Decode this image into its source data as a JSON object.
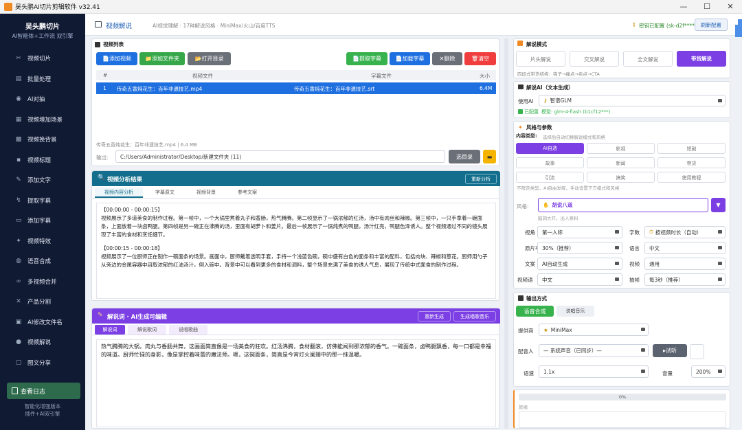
{
  "window": {
    "title": "吴头鹏AI切片剪辑软件 v32.41"
  },
  "sidebar": {
    "title": "吴头鹏切片",
    "subtitle": "AI智能体+工作流 双引擎",
    "items": [
      {
        "label": "视频切片",
        "icon": "scissors-icon"
      },
      {
        "label": "批量处理",
        "icon": "folder-icon"
      },
      {
        "label": "AI对抽",
        "icon": "ai-icon"
      },
      {
        "label": "视频增加场景",
        "icon": "film-icon"
      },
      {
        "label": "视频换背景",
        "icon": "image-icon"
      },
      {
        "label": "视频标题",
        "icon": "title-icon"
      },
      {
        "label": "添加文字",
        "icon": "pencil-icon"
      },
      {
        "label": "提取字幕",
        "icon": "extract-icon"
      },
      {
        "label": "添加字幕",
        "icon": "subtitle-icon"
      },
      {
        "label": "视频特效",
        "icon": "sparkle-icon"
      },
      {
        "label": "语音合成",
        "icon": "speech-icon"
      },
      {
        "label": "多视频合并",
        "icon": "link-icon"
      },
      {
        "label": "产品分割",
        "icon": "cross-icon"
      },
      {
        "label": "AI修改文件名",
        "icon": "rename-icon"
      },
      {
        "label": "视频解说",
        "icon": "mic-icon"
      },
      {
        "label": "图文分享",
        "icon": "share-icon"
      }
    ],
    "log_label": "查看日志",
    "footer1": "智能化增强版本",
    "footer2": "插件+AI双引擎"
  },
  "topbar": {
    "section": "视频解说",
    "desc": "AI视觉理解 · 17种解说风格 · MiniMax/火山/百度TTS",
    "key_status": "密钥已配置 (sk-d2f****)",
    "refresh_label": "刷新配置"
  },
  "video_list": {
    "title": "视频列表",
    "buttons": {
      "add_video": "添加视频",
      "add_folder": "添加文件夹",
      "open_dir": "打开目录",
      "extract_sub": "提取字幕",
      "load_sub": "加载字幕",
      "delete": "删除",
      "clear": "清空"
    },
    "columns": [
      "#",
      "视频文件",
      "字幕文件",
      "大小"
    ],
    "rows": [
      {
        "n": "1",
        "video": "传奇五香炖花生：百年非遗技艺.mp4",
        "sub": "传奇五香炖花生：百年非遗技艺.srt",
        "size": "6.4M"
      }
    ],
    "status": "传奇五香炖花生：百年非遗技艺.mp4 | 6.4 MB",
    "output_label": "输出:",
    "output_path": "C:/Users/Administrator/Desktop/新建文件夹 (11)",
    "choose_dir": "选目录"
  },
  "analysis": {
    "title": "视频分析结果",
    "reanalyze": "重新分析",
    "tabs": [
      "视频内容分析",
      "字幕原文",
      "视频背景",
      "参考文案"
    ],
    "paragraphs": [
      "【00:00:00 - 00:00:15】",
      "视频展示了多道美食的制作过程。第一帧中，一个大锅里煮着丸子和香肠，热气腾腾。第二帧显示了一锅浓郁的红汤，汤中有肉丝和辣椒。第三帧中，一只手拿着一碗面条，上面放着一块卤鸭腿。第四帧是另一碗正在沸腾的汤，里面有胡萝卜和姜片。最后一帧展示了一锅炖煮的鸭腿，汤汁红亮，鸭腿色泽诱人。整个视频通过不同的镜头展现了丰富的食材和烹饪细节。",
      "【00:00:15 - 00:00:18】",
      "视频展示了一位厨师正在制作一碗面条的场景。画面中，厨师戴着透明手套，手持一个浅蓝色碗，碗中盛有白色的面条和丰富的配料，包括肉块、辣椒和葱花。厨师用勺子从旁边的金属容器中舀取浓郁的红油汤汁，倒入碗中。背景中可以看到更多的食材和调料，整个场景充满了美食的诱人气息，展现了传统中式面食的制作过程。"
    ]
  },
  "narration": {
    "title": "解说词 · AI生成可编辑",
    "regen": "重新生成",
    "gen_music": "生成唱歌音乐",
    "tabs": [
      "解说词",
      "解说歌词",
      "说唱歌曲"
    ],
    "text": "热气腾腾的大锅，肉丸与香肠共舞，这画面简直像是一场美食的狂欢。红汤沸腾，食材翻滚，仿佛能闻到那浓郁的香气。一碗面条，卤鸭腿飘香，每一口都是幸福的味道。厨师忙碌的身影，像是掌控着味蕾的魔法师。嗯，这碗面条，简直是今宵灯火阑珊中的那一抹温暖。"
  },
  "mode": {
    "title": "解说模式",
    "options": [
      "片头解说",
      "交叉解说",
      "全文解说",
      "带货解说"
    ],
    "active": "带货解说",
    "hint": "四段式带货结构：钩子→痛点→卖点→CTA"
  },
  "ai": {
    "title": "解说AI（文本生成）",
    "use_label": "使用AI",
    "model_select": "智谱GLM",
    "configured": "已配置",
    "model_info": "模型: glm-4-flash (b1cf12***)"
  },
  "style": {
    "title": "风格与参数",
    "content_type_label": "内容类型:",
    "content_type_hint": "选择后自动切换解说模式和风格",
    "types": [
      "AI自选",
      "影视",
      "短剧",
      "故事",
      "新闻",
      "带货",
      "引流",
      "搞笑",
      "使用教程"
    ],
    "active_type": "AI自选",
    "type_hint": "不限定类型，AI自由发挥，手动设置下方模式和风格",
    "style_label": "风格:",
    "style_value": "胡说八道",
    "style_hint": "脑洞大开，出人意料",
    "params": [
      {
        "label": "视角",
        "value": "第一人称",
        "label2": "字数",
        "value2": "按视频时长（自动）"
      },
      {
        "label": "原片率",
        "value": "30%（推荐）",
        "label2": "语言",
        "value2": "中文"
      },
      {
        "label": "文案",
        "value": "AI自动生成",
        "label2": "视频",
        "value2": "通用"
      },
      {
        "label": "视频语",
        "value": "中文",
        "label2": "抽帧",
        "value2": "每3秒（推荐）"
      }
    ]
  },
  "output": {
    "title": "输出方式",
    "tabs": [
      "语音合成",
      "说唱音乐"
    ],
    "provider_label": "提供商",
    "provider_value": "MiniMax",
    "voice_label": "配音人",
    "voice_value": "— 系统声音（已同步）—",
    "try_label": "试听",
    "speed_label": "语速",
    "speed_value": "1.1x",
    "volume_label": "音量",
    "volume_value": "200%"
  },
  "progress": {
    "percent_text": "0%",
    "status": "就绪"
  },
  "colors": {
    "sidebar": "#111a33",
    "accent_blue": "#1e6fe0",
    "purple": "#7b3fe4",
    "green": "#37b24d",
    "orange": "#f59f00",
    "red": "#f03e3e",
    "teal": "#126e8c"
  }
}
